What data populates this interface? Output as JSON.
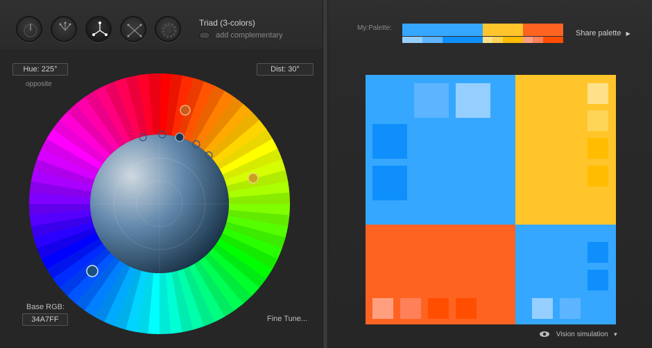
{
  "scheme": {
    "title": "Triad (3-colors)",
    "add_complementary_label": "add complementary",
    "mode_buttons": [
      "mono-icon",
      "complement-icon",
      "triad-icon",
      "tetrad-icon",
      "analogic-icon"
    ]
  },
  "controls": {
    "hue_label": "Hue: 225°",
    "opposite_label": "opposite",
    "dist_label": "Dist: 30°",
    "base_rgb_label": "Base RGB:",
    "base_rgb_value": "34A7FF",
    "fine_tune_label": "Fine Tune..."
  },
  "palette": {
    "label": "My:Palette:",
    "share_label": "Share palette",
    "colors": {
      "primary": "#36A7FF",
      "yellow": "#FFC52B",
      "orange": "#FF6322"
    }
  },
  "preview_colors": {
    "blue": "#36A7FF",
    "blue_dark": "#0E8FFB",
    "blue_light": "#95CFFF",
    "blue_mid": "#5DB5FF",
    "yellow": "#FFC52B",
    "yellow_light": "#FFE189",
    "yellow_mid": "#FFD557",
    "yellow_dark": "#FFBC00",
    "orange": "#FF6322",
    "orange_light": "#FF9F80",
    "orange_mid": "#FF8059",
    "orange_dark": "#FF4E00"
  },
  "footer": {
    "vision_label": "Vision simulation"
  }
}
